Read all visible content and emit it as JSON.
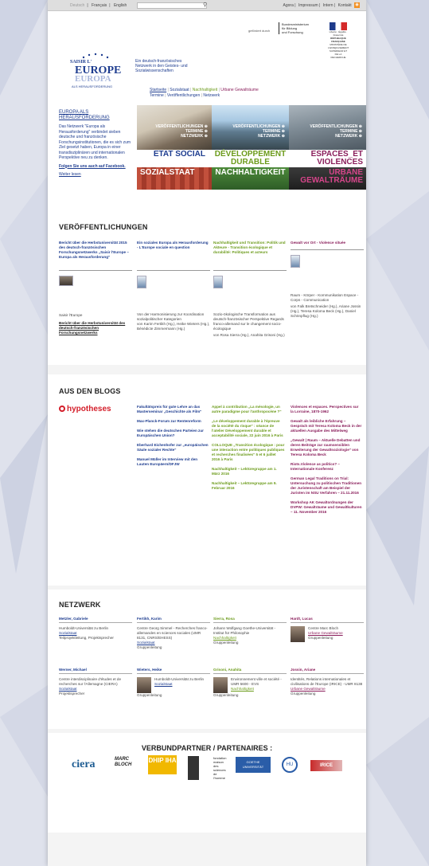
{
  "topbar": {
    "lang_de": "Deutsch",
    "lang_fr": "Français",
    "lang_en": "English",
    "sep": "|",
    "links": [
      "Agora",
      "Impressum",
      "Intern",
      "Kontakt"
    ],
    "rss": "rss-icon"
  },
  "header": {
    "logo": {
      "line1": "SAISIR L'",
      "line2": "EUROPE",
      "line3": "EUROPA",
      "line4": "ALS HERAUSFORDERUNG"
    },
    "tagline": "Ein deutsch-französisches Netzwerk in den Geistes- und Sozialwissenschaften",
    "funded": "gefördert durch",
    "bmbf": [
      "Bundesministerium",
      "für Bildung",
      "und Forschung"
    ],
    "rf_top": "Liberté · Égalité · Fraternité",
    "rf_name": "RÉPUBLIQUE FRANÇAISE",
    "rf_min": "MINISTÈRE DE L'ENSEIGNEMENT SUPÉRIEUR ET DE LA RECHERCHE"
  },
  "nav": {
    "row1": [
      "Startseite",
      "Sozialstaat",
      "Nachhaltigkeit",
      "Urbane Gewalträume"
    ],
    "row2": [
      "Termine",
      "Veröffentlichungen",
      "Netzwerk"
    ]
  },
  "intro": {
    "title": "EUROPA ALS HERAUSFORDERUNG",
    "text": "Das Netzwerk \"Europa als Herausforderung\" verbindet sieben deutsche und französische Forschungsinstitutionen, die es sich zum Ziel gesetzt haben, Europa in einer transdisziplinären und internationalen Perspektive neu zu denken.",
    "facebook": "Folgen Sie uns auch auf Facebook.",
    "more": "Weiter lesen"
  },
  "panels": [
    {
      "menu": [
        "VERÖFFENTLICHUNGEN",
        "TERMINE",
        "NETZWERK"
      ],
      "fr": "ETAT SOCIAL",
      "de": "SOZIALSTAAT",
      "color": "#1d3c8f"
    },
    {
      "menu": [
        "VERÖFFENTLICHUNGEN",
        "TERMINE",
        "NETZWERK"
      ],
      "fr": "DÉVELOPPEMENT DURABLE",
      "de": "NACHHALTIGKEIT",
      "color": "#6c9b1b"
    },
    {
      "menu": [
        "VERÖFFENTLICHUNGEN",
        "TERMINE",
        "NETZWERK"
      ],
      "fr": "ESPACES_ET VIOLENCES",
      "de": "URBANE GEWALTRÄUME",
      "color": "#8a1e5b"
    }
  ],
  "pubs": {
    "heading": "VERÖFFENTLICHUNGEN",
    "cols": [
      {
        "title": "Bericht über die Herbstuniversität 2015 des deutsch-französischen Forschungsnetzwerks „Saisir l'Europe – Europa als Herausforderung\"",
        "desc": "Saisir l'Europe",
        "link": "Bericht über die Herbstuniversität des deutsch-französischen Forschungsnetzwerks"
      },
      {
        "title": "Ein soziales Europa als Herausforderung - L'Europe sociale en question",
        "desc": "Von der Harmonisierung zur Koordination sozialpolitischer Kategorien",
        "authors": "von Karim Fertikh (Hg.), Heike Wieters (Hg.), Bénédicte Zimmermann (Hg.)"
      },
      {
        "title": "Nachhaltigkeit und Transition: Politik und Akteure - Transition écologique et durabilité: Politiques et acteurs",
        "desc": "Sozio-ökologische Transformation aus deutsch-französischer Perspektive Regards franco-allemand sur le changement socio-écologique",
        "authors": "von Rosa Sierra (Hg.), Anahita Grisoni (Hg.)"
      },
      {
        "title": "Gewalt vor Ort - Violence située",
        "desc": "Raum - Körper - Kommunikation Espace - Corps - Communication",
        "authors": "von Falk Bretschneider (Hg.), Ariane Jossin (Hg.), Teresa Koloma Beck (Hg.), Daniel Schönpflug (Hg.)"
      }
    ]
  },
  "blogs": {
    "heading": "AUS DEN BLOGS",
    "logo": "hypotheses",
    "col1": [
      "Fakultätspreis für gute Lehre an das Masterseminar „Geschichte als Film\"",
      "Max-Planck-Forum zur Rentenreform",
      "Wie stehen die deutschen Parteien zur Europäischen Union?",
      "Eberhard Eichenhofer zur „europäischen Säule sozialer Rechte\"",
      "Manuel Müller im Interview mit den Lauten Europäern/DFJW"
    ],
    "col2": [
      "Appel à contribution „La mésologie, un autre paradigme pour l'anthropocène ?\"",
      "„Le développement durable à l'épreuve de la société du risque\" : séance de l'atelier Développement durable et acceptabilité sociale, 22 juin 2016 à Paris",
      "COLLOQUE „Transition écologique : pour une interaction entre politiques publiques et recherches finalisées\" 5 et 6 juillet 2016 à Paris",
      "Nachhaltigkeit – Lektüregruppe am 1. März 2016",
      "Nachhaltigkeit – Lektüregruppe am 9. Februar 2016"
    ],
    "col3": [
      "Violences et espaces. Perspectives sur la Lorraine, 1870-1962",
      "Gewalt als leibliche Erfahrung – Gespräch mit Teresa Koloma Beck in der aktuellen Ausgabe des Mittelweg",
      "„Gewalt | Raum – Aktuelle Debatten und deren Beiträge zur raumsensiblen Erweiterung der Gewaltsoziologie\" von Teresa Koloma Beck",
      "Riots.Violence as politics? – Internationale Konferenz",
      "German Legal Traditions on Trial: Untersuchung zu politischen Traditionen der Juristenschaft am Beispiel der Juristen im NSU Verfahren – 21.11.2016",
      "Workshop AK Gewaltordnungen der DVPW: Gewalträume und Gewaltkulturen – 11. November 2016"
    ]
  },
  "network": {
    "heading": "NETZWERK",
    "people": [
      {
        "name": "Metzler, Gabriele",
        "lines": [
          "Humboldt-Universität zu Berlin"
        ],
        "link": "Sozialstaat",
        "role": "Teilprojektleitung, Projektsprecher",
        "photo": false
      },
      {
        "name": "Fertikh, Karim",
        "lines": [
          "Centre Georg Simmel - Recherches franco-allemandes en sciences sociales (UMR 8131, CNRS/EHESS)"
        ],
        "link": "Sozialstaat",
        "role": "Gruppenleitung",
        "photo": false
      },
      {
        "name": "Sierra, Rosa",
        "lines": [
          "Johann Wolfgang Goethe-Universität - Institut für Philosophie"
        ],
        "link": "Nachhaltigkeit",
        "role": "Gruppenleitung",
        "photo": false
      },
      {
        "name": "Hardt, Lucas",
        "lines": [
          "Centre Marc Bloch"
        ],
        "link": "Urbane Gewalträume",
        "role": "Gruppenleitung",
        "photo": true
      },
      {
        "name": "Werner, Michael",
        "lines": [
          "Centre interdisciplinaire d'études et de recherches sur l'Allemagne (CIERA)"
        ],
        "link": "Sozialstaat",
        "role": "Projektsprecher",
        "photo": false
      },
      {
        "name": "Wieters, Heike",
        "lines": [
          "Humboldt-Universität zu Berlin"
        ],
        "link": "Sozialstaat",
        "role": "Gruppenleitung",
        "photo": true
      },
      {
        "name": "Grisoni, Anahita",
        "lines": [
          "Environnement ville et société - UMR 5600 - EVS"
        ],
        "link": "Nachhaltigkeit",
        "role": "Gruppenleitung",
        "photo": true
      },
      {
        "name": "Jossin, Ariane",
        "lines": [
          "Identités, Relations internationales et civilisations de l'Europe (IRICE) - UMR 8138"
        ],
        "link": "Urbane Gewalträume",
        "role": "Gruppenleitung",
        "photo": false
      }
    ]
  },
  "partners": {
    "heading": "VERBUNDPARTNER / PARTENAIRES :",
    "logos": [
      "ciera",
      "MARC BLOCH",
      "DHIP IHA",
      "fondation maison des sciences de l'homme",
      "GOETHE UNIVERSITÄT",
      "HU",
      "IRICE"
    ]
  }
}
